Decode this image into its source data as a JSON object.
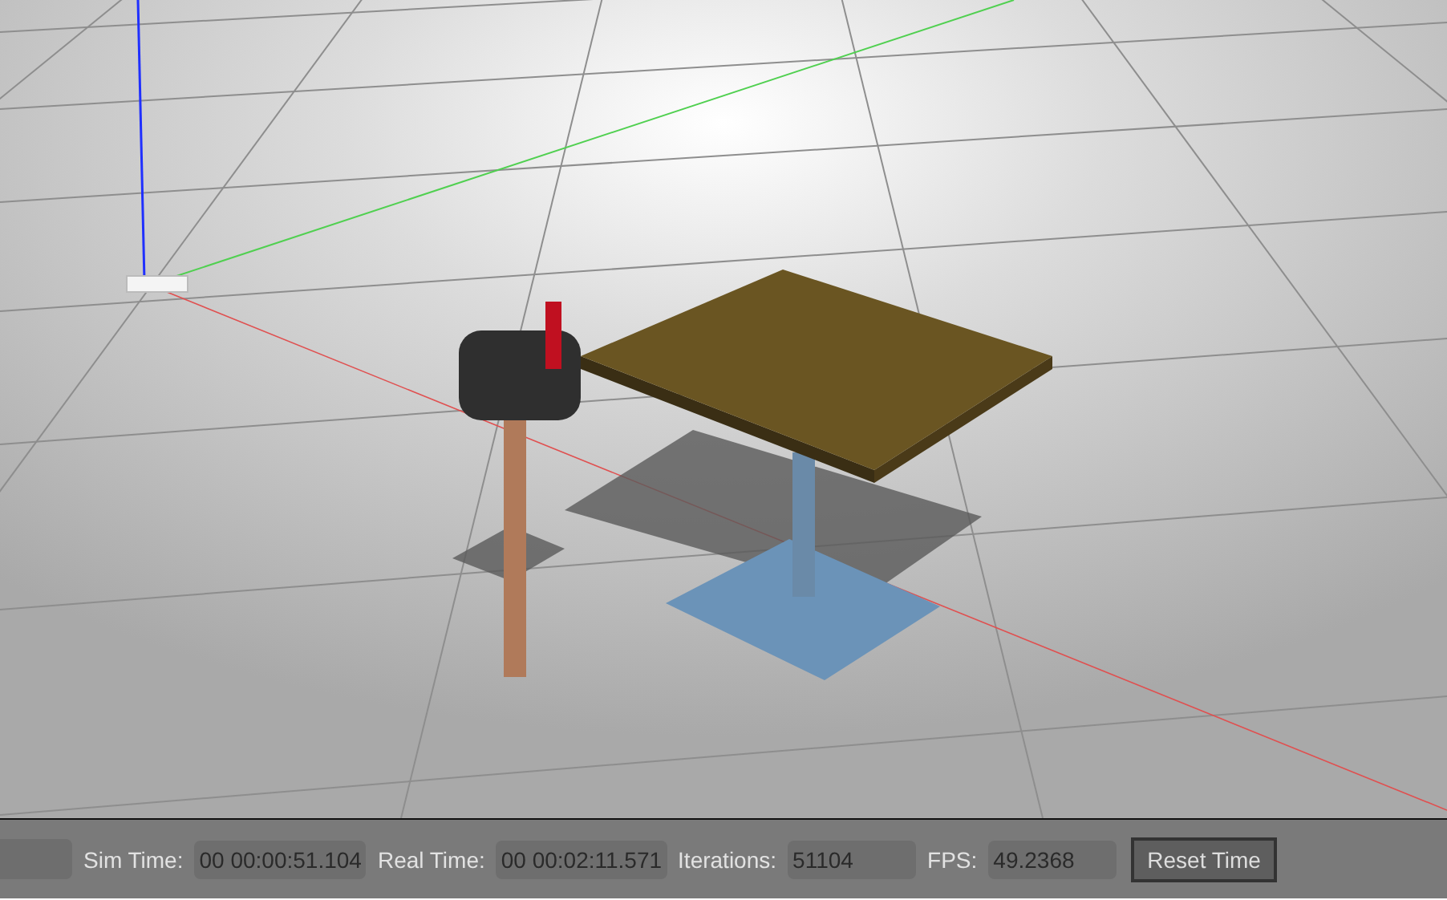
{
  "status_bar": {
    "fields": [
      {
        "label": "Sim Time:",
        "value": "00 00:00:51.104"
      },
      {
        "label": "Real Time:",
        "value": "00 00:02:11.571"
      },
      {
        "label": "Iterations:",
        "value": "51104"
      },
      {
        "label": "FPS:",
        "value": "49.2368"
      }
    ],
    "button": "Reset Time"
  }
}
